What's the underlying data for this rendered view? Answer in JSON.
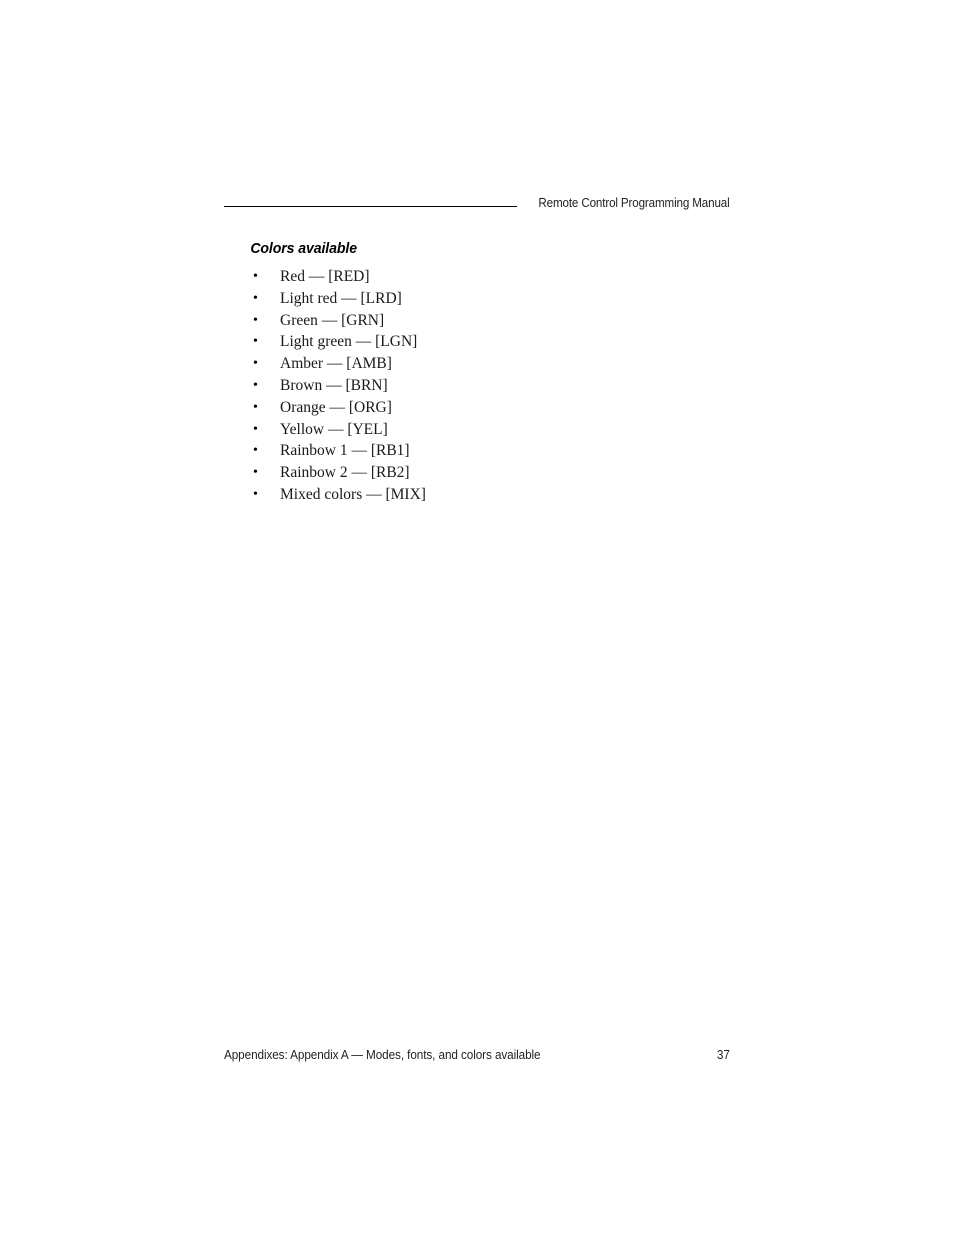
{
  "header": {
    "title": "Remote Control Programming Manual",
    "rule_color": "#000000"
  },
  "main": {
    "section_heading": "Colors available",
    "bullet_glyph": "•",
    "colors": [
      {
        "label": "Red — [RED]",
        "name": "Red",
        "code": "RED"
      },
      {
        "label": "Light red — [LRD]",
        "name": "Light red",
        "code": "LRD"
      },
      {
        "label": "Green — [GRN]",
        "name": "Green",
        "code": "GRN"
      },
      {
        "label": "Light green — [LGN]",
        "name": "Light green",
        "code": "LGN"
      },
      {
        "label": "Amber — [AMB]",
        "name": "Amber",
        "code": "AMB"
      },
      {
        "label": "Brown — [BRN]",
        "name": "Brown",
        "code": "BRN"
      },
      {
        "label": "Orange — [ORG]",
        "name": "Orange",
        "code": "ORG"
      },
      {
        "label": "Yellow — [YEL]",
        "name": "Yellow",
        "code": "YEL"
      },
      {
        "label": "Rainbow 1 — [RB1]",
        "name": "Rainbow 1",
        "code": "RB1"
      },
      {
        "label": "Rainbow 2 — [RB2]",
        "name": "Rainbow 2",
        "code": "RB2"
      },
      {
        "label": "Mixed colors — [MIX]",
        "name": "Mixed colors",
        "code": "MIX"
      }
    ]
  },
  "footer": {
    "text": "Appendixes: Appendix A — Modes, fonts, and colors available",
    "page_number": "37"
  },
  "colors": {
    "text": "#231f20",
    "body_text": "#1a1a1a",
    "page_background": "#ffffff"
  }
}
